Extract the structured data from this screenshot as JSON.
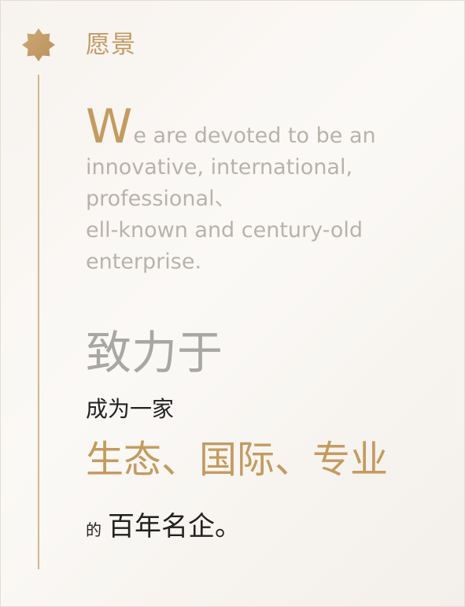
{
  "header": {
    "title": "愿景"
  },
  "vision_en": {
    "dropcap": "W",
    "lines": [
      "e are devoted to be an",
      "innovative, international,",
      "professional、",
      "ell-known and century-old",
      "enterprise."
    ]
  },
  "vision_zh": {
    "headline": "致力于",
    "subline": "成为一家",
    "emphasis": "生态、国际、专业",
    "ending_small": "的",
    "ending_big": "百年名企。"
  },
  "colors": {
    "accent": "#c49b5f",
    "muted": "#b8b2aa",
    "dark": "#222222",
    "timeline": "#d3b68f"
  },
  "icons": {
    "badge": "eight-point-star-badge-icon"
  }
}
